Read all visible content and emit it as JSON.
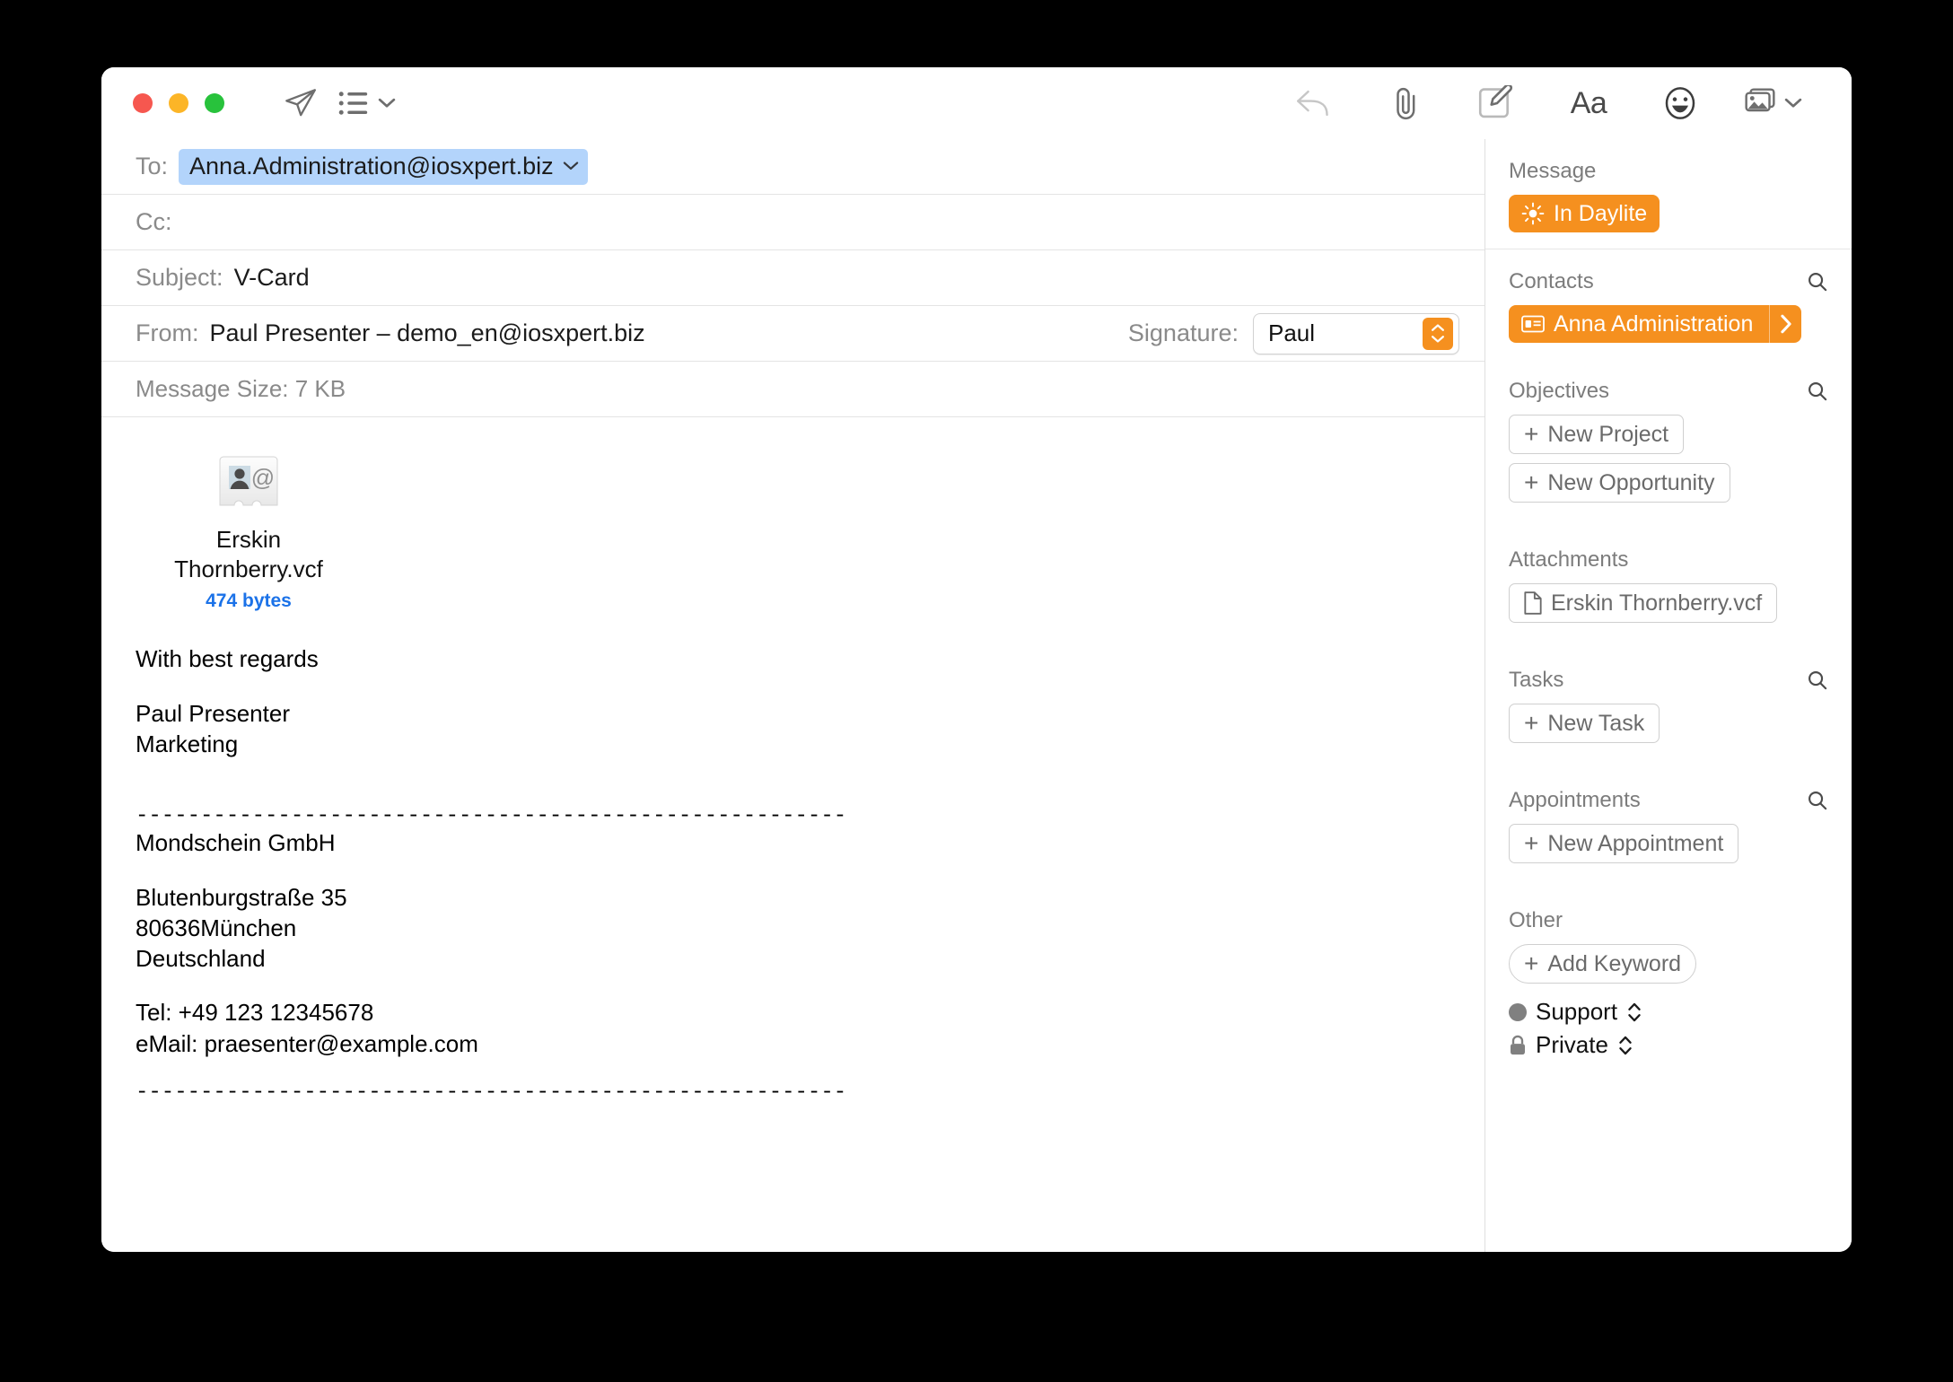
{
  "window": {
    "traffic_lights": [
      "close-red",
      "minimize-yellow",
      "zoom-green"
    ],
    "colors": {
      "red": "#f6574f",
      "yellow": "#fcb527",
      "green": "#28c23c",
      "accent_orange": "#f5901f",
      "token_blue": "#b3d4fb",
      "link_blue": "#1b72e8"
    }
  },
  "toolbar": {
    "left_icons": [
      {
        "name": "send-icon",
        "label": "Send"
      },
      {
        "name": "list-format-icon",
        "label": "Format List"
      }
    ],
    "right_icons": [
      {
        "name": "reply-arrow-icon",
        "label": "Reply"
      },
      {
        "name": "paperclip-icon",
        "label": "Attach File"
      },
      {
        "name": "markup-icon",
        "label": "Markup"
      },
      {
        "name": "font-format-icon",
        "label": "Aa"
      },
      {
        "name": "emoji-icon",
        "label": "Emoji"
      },
      {
        "name": "photo-browser-icon",
        "label": "Photo Browser"
      }
    ],
    "aa_label": "Aa"
  },
  "compose": {
    "to_label": "To:",
    "to_value": "Anna.Administration@iosxpert.biz",
    "cc_label": "Cc:",
    "cc_value": "",
    "cc_placeholder": "",
    "subject_label": "Subject:",
    "subject_value": "V-Card",
    "from_label": "From:",
    "from_value": "Paul Presenter – demo_en@iosxpert.biz",
    "signature_label": "Signature:",
    "signature_value": "Paul",
    "message_size": "Message Size: 7 KB"
  },
  "attachment": {
    "filename": "Erskin Thornberry.vcf",
    "filename_line1": "Erskin",
    "filename_line2": "Thornberry.vcf",
    "size": "474 bytes",
    "icon": "vcard-icon"
  },
  "message_body": {
    "greeting": "With best regards",
    "sender_name": "Paul Presenter",
    "sender_dept": "Marketing",
    "divider_top": "-------------------------------------------------------",
    "company": "Mondschein GmbH",
    "street": "Blutenburgstraße 35",
    "city": "80636München",
    "country": "Deutschland",
    "tel": "Tel: +49 123 12345678",
    "email": "eMail: praesenter@example.com",
    "divider_bottom": "-------------------------------------------------------"
  },
  "sidebar": {
    "message": {
      "title": "Message",
      "badge": "In Daylite",
      "badge_icon": "sun-icon"
    },
    "contacts": {
      "title": "Contacts",
      "search_icon": "search-icon",
      "items": [
        {
          "label": "Anna Administration",
          "icon": "contact-card-icon",
          "arrow": "chevron-right-icon"
        }
      ]
    },
    "objectives": {
      "title": "Objectives",
      "search_icon": "search-icon",
      "buttons": [
        {
          "label": "New Project"
        },
        {
          "label": "New Opportunity"
        }
      ]
    },
    "attachments": {
      "title": "Attachments",
      "items": [
        {
          "label": "Erskin Thornberry.vcf",
          "icon": "document-icon"
        }
      ]
    },
    "tasks": {
      "title": "Tasks",
      "search_icon": "search-icon",
      "buttons": [
        {
          "label": "New Task"
        }
      ]
    },
    "appointments": {
      "title": "Appointments",
      "search_icon": "search-icon",
      "buttons": [
        {
          "label": "New Appointment"
        }
      ]
    },
    "other": {
      "title": "Other",
      "add_keyword": "Add Keyword",
      "rows": [
        {
          "label": "Support",
          "icon": "gray-dot-icon",
          "stepper": "updown-chevron-icon"
        },
        {
          "label": "Private",
          "icon": "lock-icon",
          "stepper": "updown-chevron-icon"
        }
      ]
    }
  }
}
